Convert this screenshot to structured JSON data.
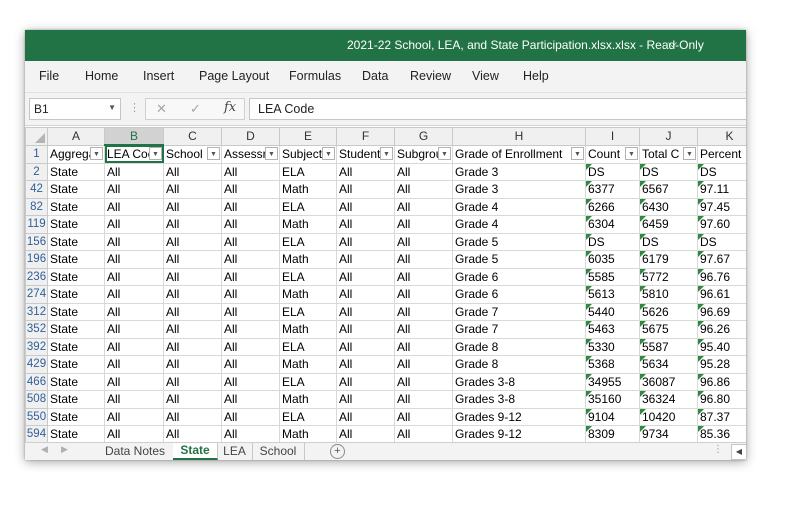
{
  "window": {
    "title": "2021-22 School, LEA, and State Participation.xlsx.xlsx  -  Read-Only",
    "title_chevron_icon": "chevron-down-icon"
  },
  "colors": {
    "accent": "#217346",
    "row_header_text": "#2e5f9a",
    "error_flag": "#2e8b3e"
  },
  "menu": [
    "File",
    "Home",
    "Insert",
    "Page Layout",
    "Formulas",
    "Data",
    "Review",
    "View",
    "Help"
  ],
  "formula_bar": {
    "name_box": "B1",
    "formula": "LEA Code",
    "fx": "fx",
    "cancel_icon": "close-icon",
    "enter_icon": "check-icon"
  },
  "columns": [
    "A",
    "B",
    "C",
    "D",
    "E",
    "F",
    "G",
    "H",
    "I",
    "J",
    "K"
  ],
  "header_row": {
    "row_number": "1",
    "cells": [
      "Aggrega",
      "LEA Coc",
      "School",
      "Assessr",
      "Subject",
      "Student",
      "Subgrou",
      "Grade of Enrollment",
      "Count",
      "Total C",
      "Percent"
    ]
  },
  "rows": [
    {
      "n": "2",
      "cells": [
        "State",
        "All",
        "All",
        "All",
        "ELA",
        "All",
        "All",
        "Grade 3",
        "DS",
        "DS",
        "DS"
      ]
    },
    {
      "n": "42",
      "cells": [
        "State",
        "All",
        "All",
        "All",
        "Math",
        "All",
        "All",
        "Grade 3",
        "6377",
        "6567",
        "97.11"
      ]
    },
    {
      "n": "82",
      "cells": [
        "State",
        "All",
        "All",
        "All",
        "ELA",
        "All",
        "All",
        "Grade 4",
        "6266",
        "6430",
        "97.45"
      ]
    },
    {
      "n": "119",
      "cells": [
        "State",
        "All",
        "All",
        "All",
        "Math",
        "All",
        "All",
        "Grade 4",
        "6304",
        "6459",
        "97.60"
      ]
    },
    {
      "n": "156",
      "cells": [
        "State",
        "All",
        "All",
        "All",
        "ELA",
        "All",
        "All",
        "Grade 5",
        "DS",
        "DS",
        "DS"
      ]
    },
    {
      "n": "196",
      "cells": [
        "State",
        "All",
        "All",
        "All",
        "Math",
        "All",
        "All",
        "Grade 5",
        "6035",
        "6179",
        "97.67"
      ]
    },
    {
      "n": "236",
      "cells": [
        "State",
        "All",
        "All",
        "All",
        "ELA",
        "All",
        "All",
        "Grade 6",
        "5585",
        "5772",
        "96.76"
      ]
    },
    {
      "n": "274",
      "cells": [
        "State",
        "All",
        "All",
        "All",
        "Math",
        "All",
        "All",
        "Grade 6",
        "5613",
        "5810",
        "96.61"
      ]
    },
    {
      "n": "312",
      "cells": [
        "State",
        "All",
        "All",
        "All",
        "ELA",
        "All",
        "All",
        "Grade 7",
        "5440",
        "5626",
        "96.69"
      ]
    },
    {
      "n": "352",
      "cells": [
        "State",
        "All",
        "All",
        "All",
        "Math",
        "All",
        "All",
        "Grade 7",
        "5463",
        "5675",
        "96.26"
      ]
    },
    {
      "n": "392",
      "cells": [
        "State",
        "All",
        "All",
        "All",
        "ELA",
        "All",
        "All",
        "Grade 8",
        "5330",
        "5587",
        "95.40"
      ]
    },
    {
      "n": "429",
      "cells": [
        "State",
        "All",
        "All",
        "All",
        "Math",
        "All",
        "All",
        "Grade 8",
        "5368",
        "5634",
        "95.28"
      ]
    },
    {
      "n": "466",
      "cells": [
        "State",
        "All",
        "All",
        "All",
        "ELA",
        "All",
        "All",
        "Grades 3-8",
        "34955",
        "36087",
        "96.86"
      ]
    },
    {
      "n": "508",
      "cells": [
        "State",
        "All",
        "All",
        "All",
        "Math",
        "All",
        "All",
        "Grades 3-8",
        "35160",
        "36324",
        "96.80"
      ]
    },
    {
      "n": "550",
      "cells": [
        "State",
        "All",
        "All",
        "All",
        "ELA",
        "All",
        "All",
        "Grades 9-12",
        "9104",
        "10420",
        "87.37"
      ]
    },
    {
      "n": "594",
      "cells": [
        "State",
        "All",
        "All",
        "All",
        "Math",
        "All",
        "All",
        "Grades 9-12",
        "8309",
        "9734",
        "85.36"
      ]
    }
  ],
  "sheet_tabs": [
    "Data Notes",
    "State",
    "LEA",
    "School"
  ],
  "active_tab": "State",
  "add_sheet": "+"
}
